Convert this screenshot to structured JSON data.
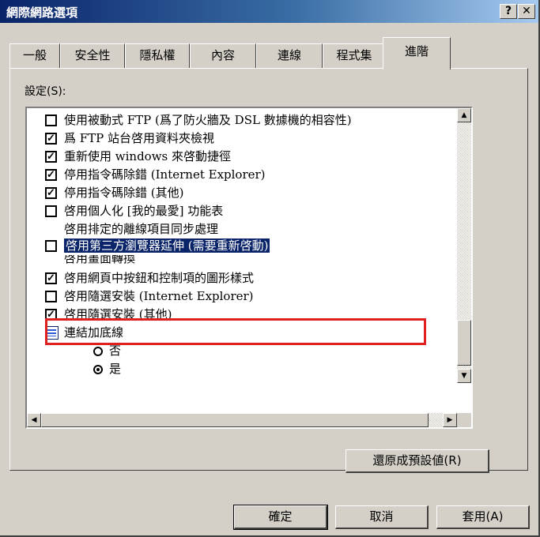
{
  "window": {
    "title": "網際網路選項",
    "help_label": "?",
    "close_label": "✕"
  },
  "tabs": [
    {
      "label": "一般",
      "active": false
    },
    {
      "label": "安全性",
      "active": false
    },
    {
      "label": "隱私權",
      "active": false
    },
    {
      "label": "內容",
      "active": false
    },
    {
      "label": "連線",
      "active": false
    },
    {
      "label": "程式集",
      "active": false
    },
    {
      "label": "進階",
      "active": true
    }
  ],
  "settings": {
    "label": "設定(S):",
    "items": [
      {
        "type": "checkbox",
        "checked": false,
        "label": "使用被動式 FTP (爲了防火牆及 DSL 數據機的相容性)"
      },
      {
        "type": "checkbox",
        "checked": true,
        "label": "爲 FTP 站台啓用資料夾檢視"
      },
      {
        "type": "checkbox",
        "checked": true,
        "label": "重新使用 windows 來啓動捷徑"
      },
      {
        "type": "checkbox",
        "checked": true,
        "label": "停用指令碼除錯 (Internet Explorer)"
      },
      {
        "type": "checkbox",
        "checked": true,
        "label": "停用指令碼除錯 (其他)"
      },
      {
        "type": "checkbox",
        "checked": false,
        "label": "啓用個人化 [我的最愛] 功能表"
      },
      {
        "type": "checkbox",
        "checked": true,
        "label": "啓用排定的離線項目同步處理"
      },
      {
        "type": "checkbox",
        "checked": false,
        "label": "啓用第三方瀏覽器延伸 (需要重新啓動)",
        "selected": true
      },
      {
        "type": "checkbox",
        "checked": true,
        "label": "啓用畫面轉換"
      },
      {
        "type": "checkbox",
        "checked": true,
        "label": "啓用網頁中按鈕和控制項的圖形樣式"
      },
      {
        "type": "checkbox",
        "checked": false,
        "label": "啓用隨選安裝 (Internet Explorer)"
      },
      {
        "type": "checkbox",
        "checked": true,
        "label": "啓用隨選安裝 (其他)"
      },
      {
        "type": "group",
        "label": "連結加底線"
      },
      {
        "type": "radio",
        "checked": false,
        "label": "否"
      },
      {
        "type": "radio",
        "checked": true,
        "label": "是"
      }
    ],
    "restore_defaults_label": "還原成預設値(R)"
  },
  "buttons": {
    "ok": "確定",
    "cancel": "取消",
    "apply": "套用(A)"
  },
  "scroll_arrows": {
    "up": "▲",
    "down": "▼",
    "left": "◀",
    "right": "▶"
  },
  "colors": {
    "title_start": "#0a246a",
    "title_end": "#a6caf0",
    "dialog_bg": "#d4d0c8",
    "highlight_border": "#e02020",
    "selection": "#0a246a"
  }
}
